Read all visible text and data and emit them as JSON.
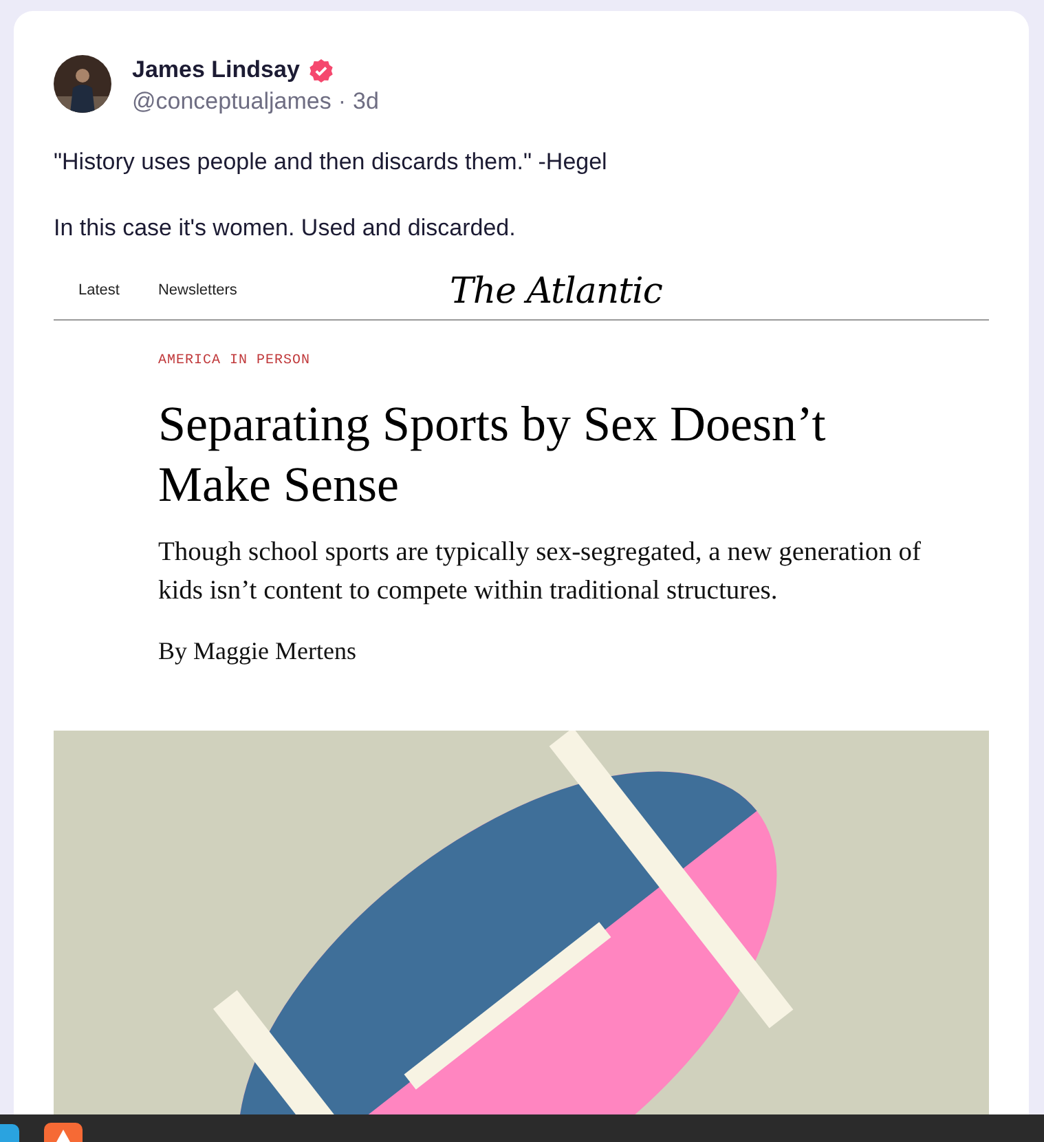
{
  "post": {
    "author": "James Lindsay",
    "verified": true,
    "handle": "@conceptualjames",
    "separator": "·",
    "time": "3d",
    "paragraphs": [
      "\"History uses people and then discards them.\" -Hegel",
      "In this case it's women. Used and discarded."
    ],
    "embed": {
      "nav": [
        "Latest",
        "Newsletters"
      ],
      "logo": "The Atlantic",
      "kicker": "AMERICA IN PERSON",
      "headline": "Separating Sports by Sex Doesn’t Make Sense",
      "dek": "Though school sports are typically sex-segregated, a new generation of kids isn’t content to compete within traditional structures.",
      "byline": "By Maggie Mertens"
    }
  }
}
